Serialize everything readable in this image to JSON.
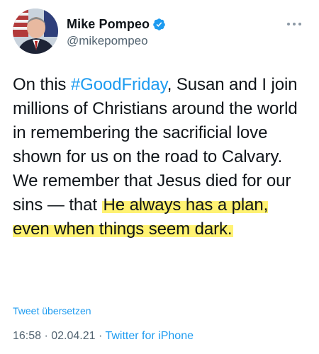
{
  "author": {
    "display_name": "Mike Pompeo",
    "handle": "@mikepompeo",
    "verified_icon": "verified-badge-icon",
    "avatar": "profile-photo"
  },
  "more_icon": "more-horizontal-icon",
  "tweet": {
    "segments": [
      {
        "text": "On this ",
        "kind": "plain"
      },
      {
        "text": "#GoodFriday",
        "kind": "hashtag"
      },
      {
        "text": ", Susan and I join millions of Christians around the world in remembering the sacrificial love shown for us on the road to Calvary. We remember that Jesus died for our sins — that ",
        "kind": "plain"
      },
      {
        "text": "He always has a plan, even when things seem dark.",
        "kind": "highlight"
      }
    ]
  },
  "translate_label": "Tweet übersetzen",
  "meta": {
    "time": "16:58",
    "separator": " · ",
    "date": "02.04.21",
    "source": "Twitter for iPhone"
  },
  "colors": {
    "link": "#1d9bf0",
    "secondary_text": "#536471",
    "highlight": "#fff05a"
  }
}
